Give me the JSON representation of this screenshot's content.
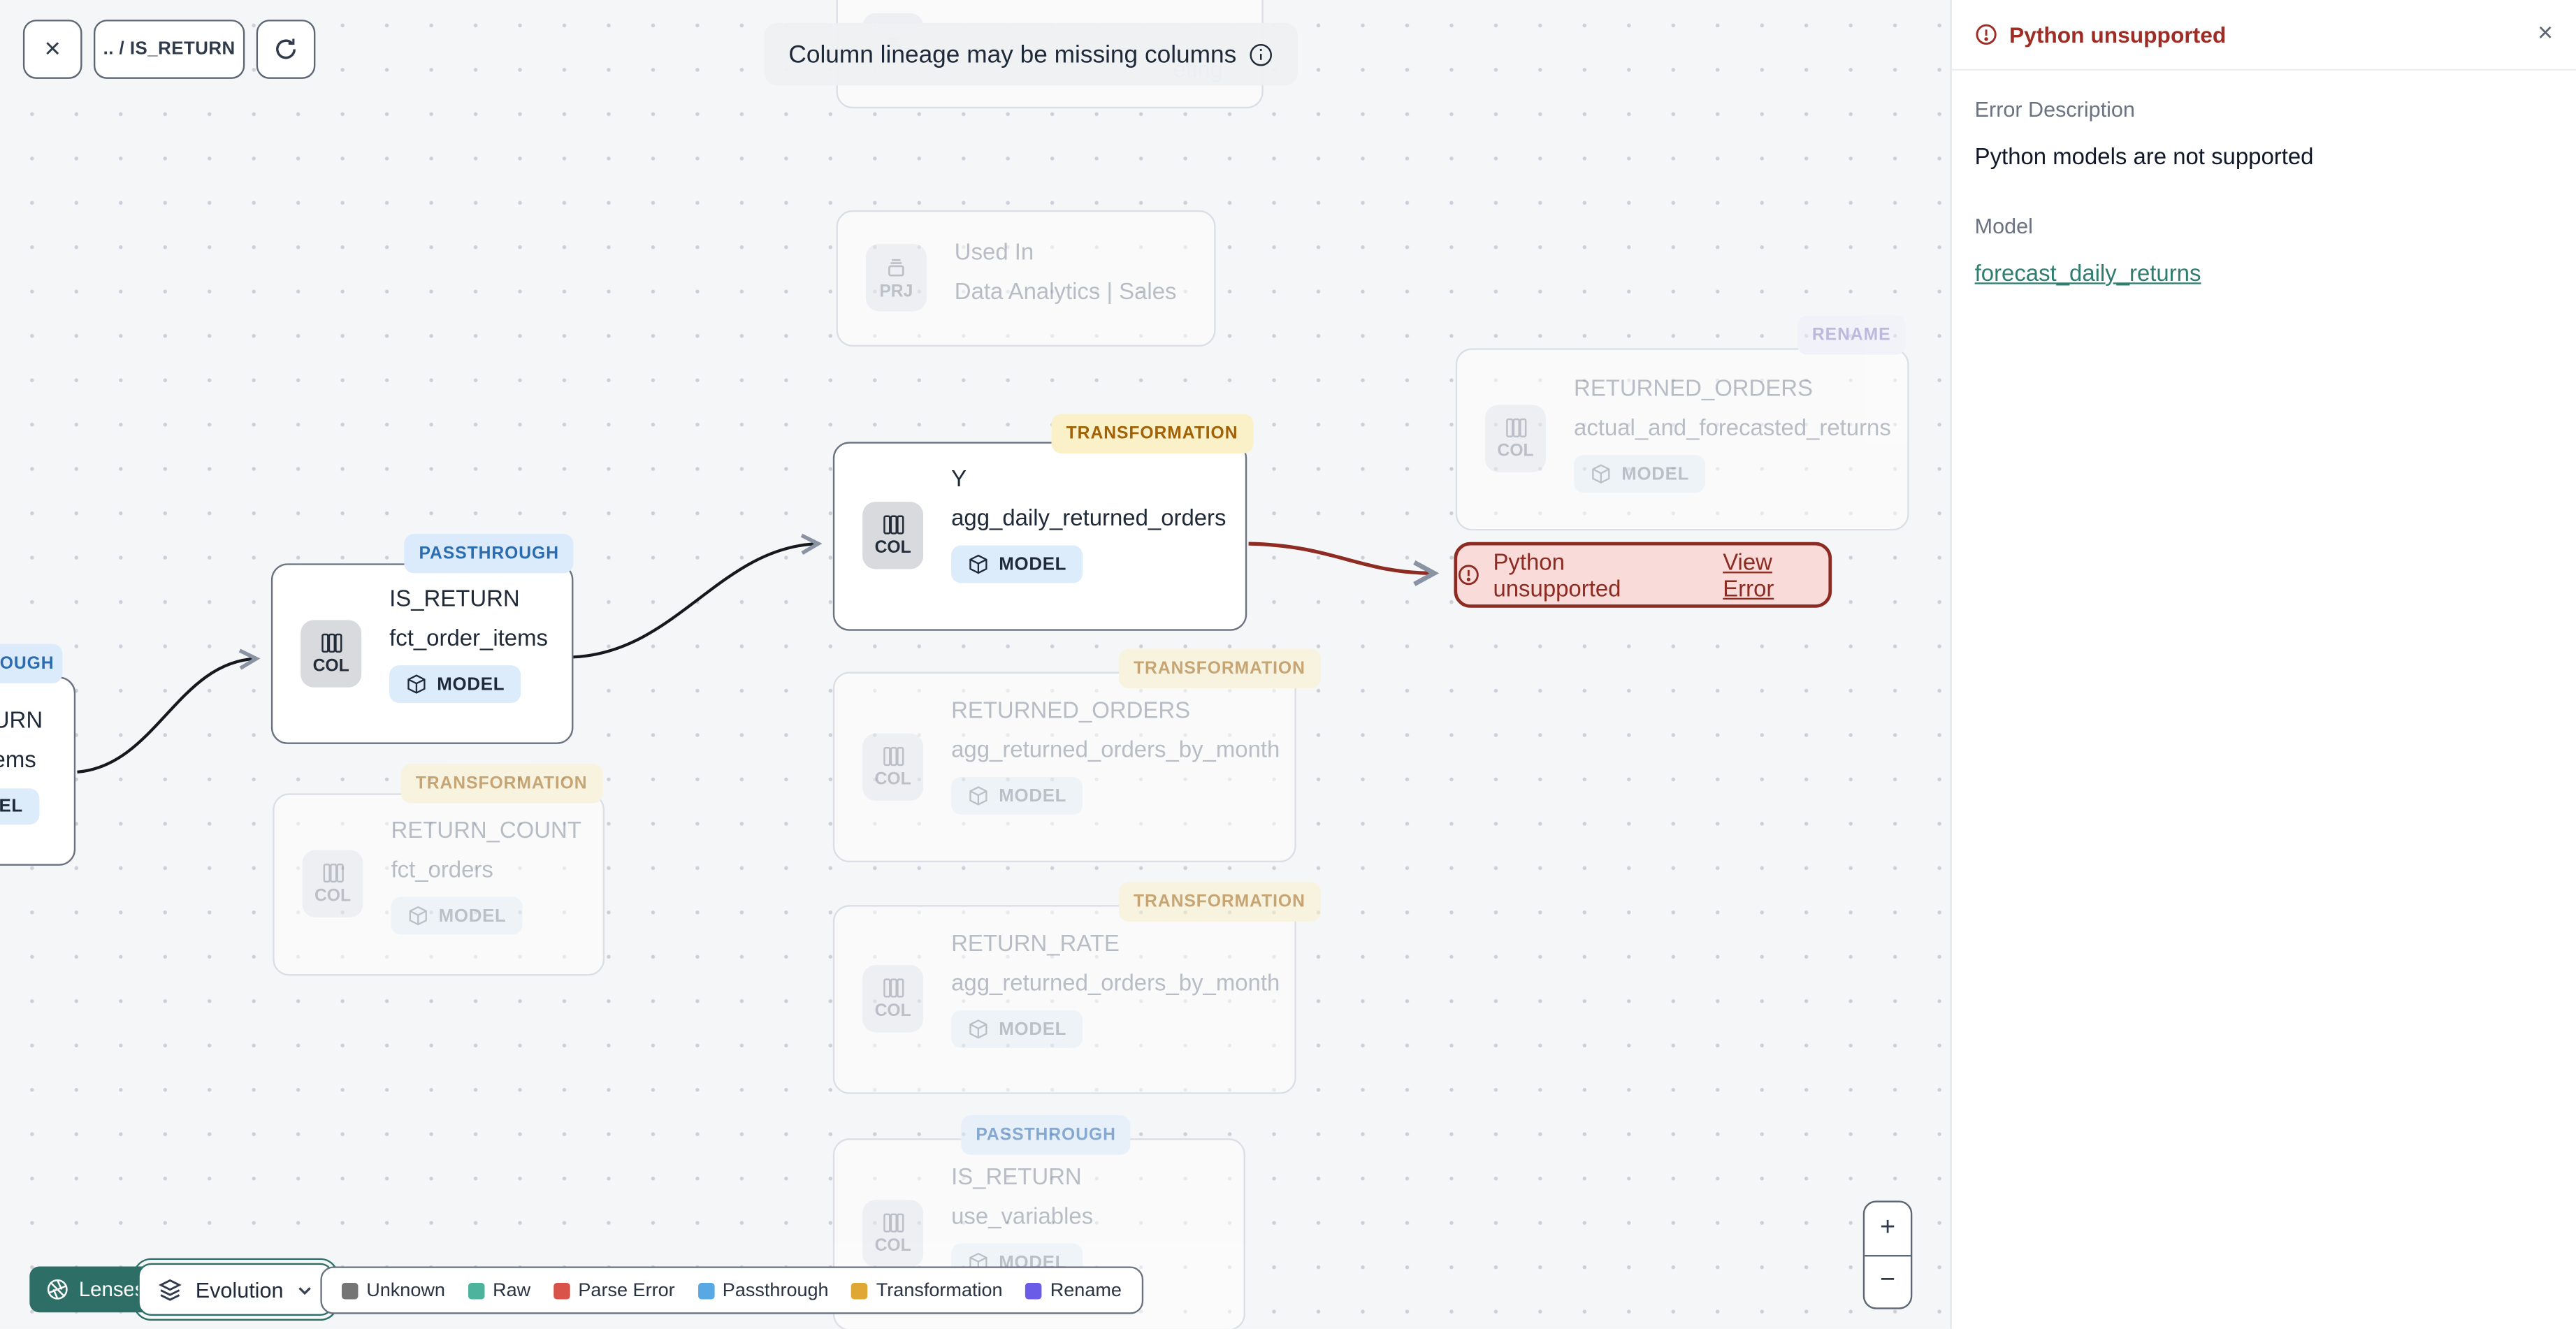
{
  "toolbar": {
    "breadcrumb": ".. / IS_RETURN"
  },
  "banner": {
    "text": "Column lineage may be missing columns"
  },
  "panel": {
    "title": "Python unsupported",
    "error_description_label": "Error Description",
    "error_description": "Python models are not supported",
    "model_label": "Model",
    "model_link": "forecast_daily_returns"
  },
  "error_badge": {
    "label": "Python unsupported",
    "action": "View Error"
  },
  "controls": {
    "lenses": "Lenses",
    "lens_selected": "Evolution",
    "zoom_in": "+",
    "zoom_out": "−"
  },
  "legend": {
    "items": [
      {
        "label": "Unknown",
        "color": "#757575"
      },
      {
        "label": "Raw",
        "color": "#4db39c"
      },
      {
        "label": "Parse Error",
        "color": "#d9534a"
      },
      {
        "label": "Passthrough",
        "color": "#57a8e3"
      },
      {
        "label": "Transformation",
        "color": "#dfa733"
      },
      {
        "label": "Rename",
        "color": "#6b5ce8"
      }
    ]
  },
  "nodes": [
    {
      "fragment": "eting"
    },
    {
      "chip": "PRJ",
      "title": "Used In",
      "subtitle": "Data Analytics | Sales"
    },
    {
      "badge": "RENAME",
      "chip": "COL",
      "title": "RETURNED_ORDERS",
      "subtitle": "actual_and_forecasted_returns",
      "model": "MODEL"
    },
    {
      "badge": "TRANSFORMATION",
      "chip": "COL",
      "title": "Y",
      "subtitle": "agg_daily_returned_orders",
      "model": "MODEL"
    },
    {
      "badge": "PASSTHROUGH",
      "chip": "COL",
      "title": "IS_RETURN",
      "subtitle": "fct_order_items",
      "model": "MODEL"
    },
    {
      "badge_fragment": "OUGH",
      "title_fragment": "URN",
      "subtitle_fragment": "ems",
      "model_fragment": "DEL"
    },
    {
      "badge": "TRANSFORMATION",
      "chip": "COL",
      "title": "RETURN_COUNT",
      "subtitle": "fct_orders",
      "model": "MODEL"
    },
    {
      "badge": "TRANSFORMATION",
      "chip": "COL",
      "title": "RETURNED_ORDERS",
      "subtitle": "agg_returned_orders_by_month",
      "model": "MODEL"
    },
    {
      "badge": "TRANSFORMATION",
      "chip": "COL",
      "title": "RETURN_RATE",
      "subtitle": "agg_returned_orders_by_month",
      "model": "MODEL"
    },
    {
      "badge": "PASSTHROUGH",
      "chip": "COL",
      "title": "IS_RETURN",
      "subtitle": "use_variables",
      "model": "MODEL"
    }
  ],
  "colors": {
    "error": "#8c2b22",
    "accent": "#2d6f66",
    "link": "#2e7d6f",
    "edge": "#111111",
    "edge_error": "#8e2b22"
  }
}
